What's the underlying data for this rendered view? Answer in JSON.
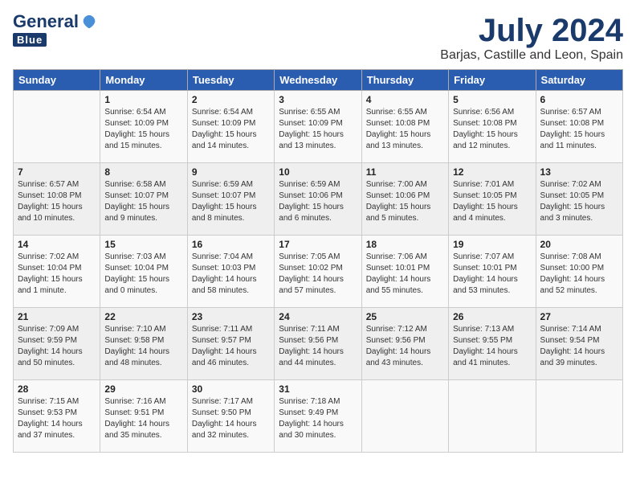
{
  "header": {
    "logo_general": "General",
    "logo_blue": "Blue",
    "title": "July 2024",
    "location": "Barjas, Castille and Leon, Spain"
  },
  "days_of_week": [
    "Sunday",
    "Monday",
    "Tuesday",
    "Wednesday",
    "Thursday",
    "Friday",
    "Saturday"
  ],
  "weeks": [
    [
      {
        "day": "",
        "text": ""
      },
      {
        "day": "1",
        "text": "Sunrise: 6:54 AM\nSunset: 10:09 PM\nDaylight: 15 hours\nand 15 minutes."
      },
      {
        "day": "2",
        "text": "Sunrise: 6:54 AM\nSunset: 10:09 PM\nDaylight: 15 hours\nand 14 minutes."
      },
      {
        "day": "3",
        "text": "Sunrise: 6:55 AM\nSunset: 10:09 PM\nDaylight: 15 hours\nand 13 minutes."
      },
      {
        "day": "4",
        "text": "Sunrise: 6:55 AM\nSunset: 10:08 PM\nDaylight: 15 hours\nand 13 minutes."
      },
      {
        "day": "5",
        "text": "Sunrise: 6:56 AM\nSunset: 10:08 PM\nDaylight: 15 hours\nand 12 minutes."
      },
      {
        "day": "6",
        "text": "Sunrise: 6:57 AM\nSunset: 10:08 PM\nDaylight: 15 hours\nand 11 minutes."
      }
    ],
    [
      {
        "day": "7",
        "text": "Sunrise: 6:57 AM\nSunset: 10:08 PM\nDaylight: 15 hours\nand 10 minutes."
      },
      {
        "day": "8",
        "text": "Sunrise: 6:58 AM\nSunset: 10:07 PM\nDaylight: 15 hours\nand 9 minutes."
      },
      {
        "day": "9",
        "text": "Sunrise: 6:59 AM\nSunset: 10:07 PM\nDaylight: 15 hours\nand 8 minutes."
      },
      {
        "day": "10",
        "text": "Sunrise: 6:59 AM\nSunset: 10:06 PM\nDaylight: 15 hours\nand 6 minutes."
      },
      {
        "day": "11",
        "text": "Sunrise: 7:00 AM\nSunset: 10:06 PM\nDaylight: 15 hours\nand 5 minutes."
      },
      {
        "day": "12",
        "text": "Sunrise: 7:01 AM\nSunset: 10:05 PM\nDaylight: 15 hours\nand 4 minutes."
      },
      {
        "day": "13",
        "text": "Sunrise: 7:02 AM\nSunset: 10:05 PM\nDaylight: 15 hours\nand 3 minutes."
      }
    ],
    [
      {
        "day": "14",
        "text": "Sunrise: 7:02 AM\nSunset: 10:04 PM\nDaylight: 15 hours\nand 1 minute."
      },
      {
        "day": "15",
        "text": "Sunrise: 7:03 AM\nSunset: 10:04 PM\nDaylight: 15 hours\nand 0 minutes."
      },
      {
        "day": "16",
        "text": "Sunrise: 7:04 AM\nSunset: 10:03 PM\nDaylight: 14 hours\nand 58 minutes."
      },
      {
        "day": "17",
        "text": "Sunrise: 7:05 AM\nSunset: 10:02 PM\nDaylight: 14 hours\nand 57 minutes."
      },
      {
        "day": "18",
        "text": "Sunrise: 7:06 AM\nSunset: 10:01 PM\nDaylight: 14 hours\nand 55 minutes."
      },
      {
        "day": "19",
        "text": "Sunrise: 7:07 AM\nSunset: 10:01 PM\nDaylight: 14 hours\nand 53 minutes."
      },
      {
        "day": "20",
        "text": "Sunrise: 7:08 AM\nSunset: 10:00 PM\nDaylight: 14 hours\nand 52 minutes."
      }
    ],
    [
      {
        "day": "21",
        "text": "Sunrise: 7:09 AM\nSunset: 9:59 PM\nDaylight: 14 hours\nand 50 minutes."
      },
      {
        "day": "22",
        "text": "Sunrise: 7:10 AM\nSunset: 9:58 PM\nDaylight: 14 hours\nand 48 minutes."
      },
      {
        "day": "23",
        "text": "Sunrise: 7:11 AM\nSunset: 9:57 PM\nDaylight: 14 hours\nand 46 minutes."
      },
      {
        "day": "24",
        "text": "Sunrise: 7:11 AM\nSunset: 9:56 PM\nDaylight: 14 hours\nand 44 minutes."
      },
      {
        "day": "25",
        "text": "Sunrise: 7:12 AM\nSunset: 9:56 PM\nDaylight: 14 hours\nand 43 minutes."
      },
      {
        "day": "26",
        "text": "Sunrise: 7:13 AM\nSunset: 9:55 PM\nDaylight: 14 hours\nand 41 minutes."
      },
      {
        "day": "27",
        "text": "Sunrise: 7:14 AM\nSunset: 9:54 PM\nDaylight: 14 hours\nand 39 minutes."
      }
    ],
    [
      {
        "day": "28",
        "text": "Sunrise: 7:15 AM\nSunset: 9:53 PM\nDaylight: 14 hours\nand 37 minutes."
      },
      {
        "day": "29",
        "text": "Sunrise: 7:16 AM\nSunset: 9:51 PM\nDaylight: 14 hours\nand 35 minutes."
      },
      {
        "day": "30",
        "text": "Sunrise: 7:17 AM\nSunset: 9:50 PM\nDaylight: 14 hours\nand 32 minutes."
      },
      {
        "day": "31",
        "text": "Sunrise: 7:18 AM\nSunset: 9:49 PM\nDaylight: 14 hours\nand 30 minutes."
      },
      {
        "day": "",
        "text": ""
      },
      {
        "day": "",
        "text": ""
      },
      {
        "day": "",
        "text": ""
      }
    ]
  ]
}
